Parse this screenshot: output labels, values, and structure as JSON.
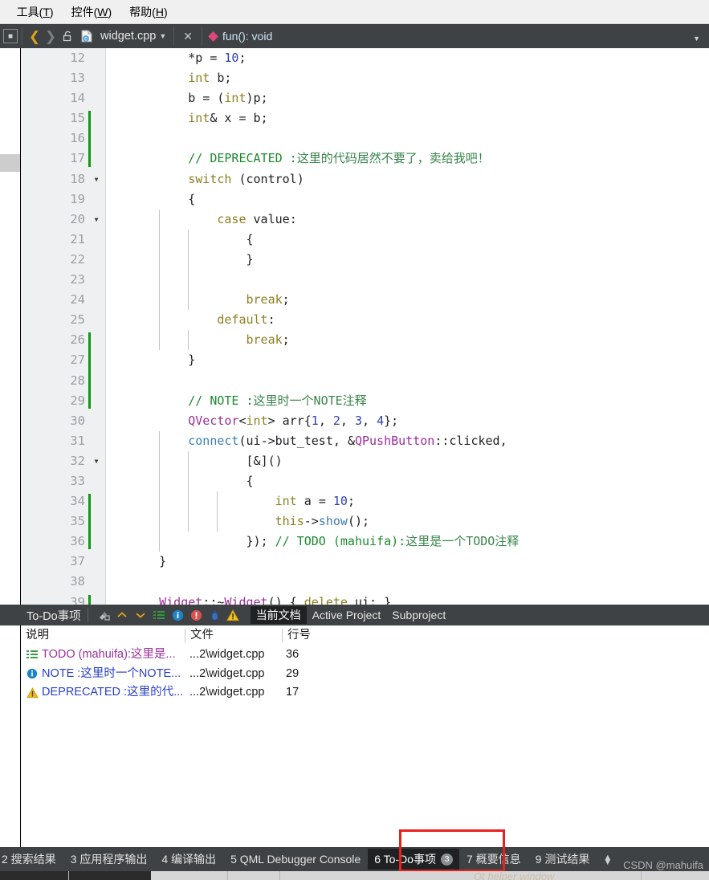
{
  "menubar": {
    "items": [
      {
        "name": "clipped-menu",
        "label": ")"
      },
      {
        "name": "tools-menu",
        "label": "工具(T)"
      },
      {
        "name": "widgets-menu",
        "label": "控件(W)"
      },
      {
        "name": "help-menu",
        "label": "帮助(H)"
      }
    ]
  },
  "editor_toolbar": {
    "sidebar_toggle_icon": "sidebar-toggle-icon",
    "back_icon": "chevron-left-icon",
    "forward_icon": "chevron-right-icon",
    "lock_icon": "unlock-icon",
    "file_icon": "cpp-file-icon",
    "filename": "widget.cpp",
    "dropdown_icon": "chevron-down-icon",
    "close_icon": "close-icon",
    "symbol_icon": "pink-diamond-icon",
    "symbol_label": "fun(): void",
    "right_dropdown_icon": "chevron-down-icon"
  },
  "code": {
    "lines": [
      {
        "num": "12",
        "fold": false,
        "changed": false
      },
      {
        "num": "13",
        "fold": false,
        "changed": false
      },
      {
        "num": "14",
        "fold": false,
        "changed": false
      },
      {
        "num": "15",
        "fold": false,
        "changed": true
      },
      {
        "num": "16",
        "fold": false,
        "changed": true
      },
      {
        "num": "17",
        "fold": false,
        "changed": true
      },
      {
        "num": "18",
        "fold": true,
        "changed": false
      },
      {
        "num": "19",
        "fold": false,
        "changed": false
      },
      {
        "num": "20",
        "fold": true,
        "changed": false
      },
      {
        "num": "21",
        "fold": false,
        "changed": false
      },
      {
        "num": "22",
        "fold": false,
        "changed": false
      },
      {
        "num": "23",
        "fold": false,
        "changed": false
      },
      {
        "num": "24",
        "fold": false,
        "changed": false
      },
      {
        "num": "25",
        "fold": false,
        "changed": false
      },
      {
        "num": "26",
        "fold": false,
        "changed": true
      },
      {
        "num": "27",
        "fold": false,
        "changed": true
      },
      {
        "num": "28",
        "fold": false,
        "changed": true
      },
      {
        "num": "29",
        "fold": false,
        "changed": true
      },
      {
        "num": "30",
        "fold": false,
        "changed": false
      },
      {
        "num": "31",
        "fold": false,
        "changed": false
      },
      {
        "num": "32",
        "fold": true,
        "changed": false
      },
      {
        "num": "33",
        "fold": false,
        "changed": false
      },
      {
        "num": "34",
        "fold": false,
        "changed": true
      },
      {
        "num": "35",
        "fold": false,
        "changed": true
      },
      {
        "num": "36",
        "fold": false,
        "changed": true
      },
      {
        "num": "37",
        "fold": false,
        "changed": false
      },
      {
        "num": "38",
        "fold": false,
        "changed": false
      },
      {
        "num": "39",
        "fold": false,
        "changed": true
      }
    ],
    "text": [
      "        *p = 10;",
      "        int b;",
      "        b = (int)p;",
      "        int& x = b;",
      "",
      "        // DEPRECATED :这里的代码居然不要了，卖给我吧！",
      "        switch (control)",
      "        {",
      "            case value:",
      "                {",
      "                }",
      "",
      "                break;",
      "            default:",
      "                break;",
      "        }",
      "",
      "        // NOTE :这里时一个NOTE注释",
      "        QVector<int> arr{1, 2, 3, 4};",
      "        connect(ui->but_test, &QPushButton::clicked,",
      "                [&]()",
      "                {",
      "                    int a = 10;",
      "                    this->show();",
      "                }); // TODO (mahuifa):这里是一个TODO注释",
      "    }",
      "",
      "    Widget::~Widget() { delete ui; }"
    ]
  },
  "todo_panel": {
    "title": "To-Do事项",
    "toolbar_icons": [
      {
        "name": "clear-icon",
        "glyph": "clear"
      },
      {
        "name": "chevron-up-icon",
        "glyph": "up"
      },
      {
        "name": "chevron-down-icon",
        "glyph": "down"
      },
      {
        "name": "list-filter-icon",
        "glyph": "list"
      },
      {
        "name": "info-filter-icon",
        "glyph": "info"
      },
      {
        "name": "error-filter-icon",
        "glyph": "error"
      },
      {
        "name": "bug-filter-icon",
        "glyph": "bug"
      },
      {
        "name": "warning-filter-icon",
        "glyph": "warning"
      }
    ],
    "scope_tabs": [
      {
        "label": "当前文档",
        "active": true
      },
      {
        "label": "Active Project",
        "active": false
      },
      {
        "label": "Subproject",
        "active": false
      }
    ],
    "columns": [
      {
        "label": "说明"
      },
      {
        "label": "文件"
      },
      {
        "label": "行号"
      }
    ],
    "rows": [
      {
        "icon": "list-icon",
        "desc": "TODO (mahuifa):这里是...",
        "file": "...2\\widget.cpp",
        "line": "36",
        "kind": "todo"
      },
      {
        "icon": "info-icon",
        "desc": "NOTE :这里时一个NOTE...",
        "file": "...2\\widget.cpp",
        "line": "29",
        "kind": "note"
      },
      {
        "icon": "warning-icon",
        "desc": "DEPRECATED :这里的代...",
        "file": "...2\\widget.cpp",
        "line": "17",
        "kind": "deprecated"
      }
    ]
  },
  "statusbar": {
    "items": [
      {
        "label": "2 搜索结果",
        "active": false
      },
      {
        "label": "3 应用程序输出",
        "active": false
      },
      {
        "label": "4 编译输出",
        "active": false
      },
      {
        "label": "5 QML Debugger Console",
        "active": false
      },
      {
        "label": "6 To-Do事项",
        "active": true,
        "badge": "3"
      },
      {
        "label": "7 概要信息",
        "active": false
      },
      {
        "label": "9 测试结果",
        "active": false
      }
    ],
    "sort_icon": "updown-arrows-icon"
  },
  "annotation": {
    "highlight_color": "#e8201e",
    "watermark": "CSDN @mahuifa"
  },
  "colors": {
    "toolbar_bg": "#3f4244",
    "active_tab_bg": "#1f2123",
    "gutter_bg": "#eff0f1",
    "change_marker": "#169216",
    "comment": "#1a8a2e",
    "keyword": "#8d8021",
    "type": "#9a2f9a",
    "number": "#2f3fb0",
    "function": "#3a7fb8"
  }
}
